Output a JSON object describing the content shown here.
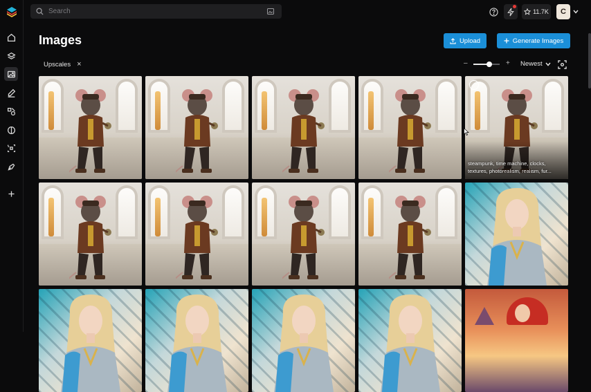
{
  "search": {
    "placeholder": "Search"
  },
  "header": {
    "stars": "11.7K",
    "avatar_initial": "C"
  },
  "page": {
    "title": "Images",
    "upload_label": "Upload",
    "generate_label": "Generate Images"
  },
  "filter": {
    "chip": "Upscales",
    "remove": "×"
  },
  "toolbar": {
    "zoom_minus": "–",
    "zoom_plus": "+",
    "zoom_level": 0.6,
    "sort": "Newest"
  },
  "rail": [
    "home",
    "layers",
    "images",
    "edit",
    "shapes",
    "circle-half",
    "crop",
    "pen-tool",
    "add"
  ],
  "grid": {
    "row1": [
      "steampunk-mouse",
      "steampunk-mouse",
      "steampunk-mouse",
      "steampunk-mouse",
      "steampunk-mouse"
    ],
    "row2": [
      "steampunk-mouse",
      "steampunk-mouse",
      "steampunk-mouse",
      "steampunk-mouse",
      "blonde-warrior"
    ],
    "row3": [
      "blonde-warrior",
      "blonde-warrior",
      "blonde-warrior",
      "blonde-warrior",
      "red-hair-sunset"
    ],
    "caption": "steampunk, time machine, clocks, textures, photorealism, realism, fur..."
  },
  "colors": {
    "accent": "#1b8fd8",
    "background": "#0b0b0c",
    "notification": "#e53935"
  }
}
